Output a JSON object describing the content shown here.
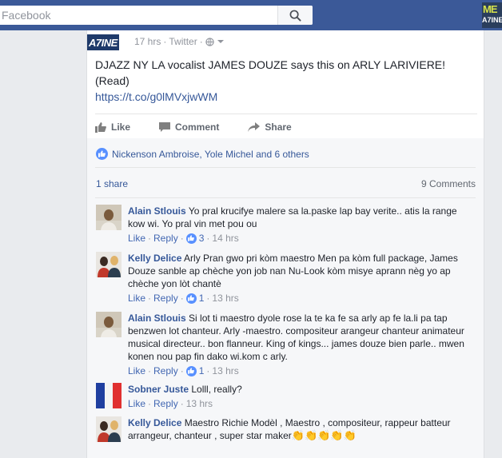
{
  "topbar": {
    "search_placeholder": "Facebook",
    "side_logo_top": "ME",
    "side_logo_bottom": "A7INE"
  },
  "post": {
    "avatar_text": "A7INE",
    "meta_time": "17 hrs",
    "meta_sep": "·",
    "meta_source": "Twitter",
    "meta_sep2": "·",
    "text": "DJAZZ NY LA vocalist JAMES DOUZE says this on ARLY LARIVIERE! (Read)",
    "link": "https://t.co/g0lMVxjwWM",
    "actions": {
      "like": "Like",
      "comment": "Comment",
      "share": "Share"
    },
    "likers": "Nickenson Ambroise, Yole Michel and 6 others",
    "shares": "1 share",
    "comments_count": "9 Comments"
  },
  "comments": [
    {
      "name": "Alain Stlouis",
      "text": "Yo pral krucifye malere sa la.paske lap bay verite.. atis la range kow wi. Yo pral vin met pou ou",
      "like": "Like",
      "reply": "Reply",
      "sep": "·",
      "likes": "3",
      "time": "14 hrs"
    },
    {
      "name": "Kelly Delice",
      "text": "Arly Pran gwo pri kòm maestro Men pa kòm full package, James Douze sanble ap chèche yon job nan Nu-Look kòm misye aprann nèg yo ap chèche yon lòt chantè",
      "like": "Like",
      "reply": "Reply",
      "sep": "·",
      "likes": "1",
      "time": "13 hrs"
    },
    {
      "name": "Alain Stlouis",
      "text": "Si lot ti maestro dyole rose la te ka fe sa arly ap fe la.li pa tap benzwen lot chanteur. Arly -maestro. compositeur arangeur chanteur animateur musical directeur.. bon flanneur. King of kings... james douze bien parle.. mwen konen nou pap fin dako wi.kom c arly.",
      "like": "Like",
      "reply": "Reply",
      "sep": "·",
      "likes": "1",
      "time": "13 hrs"
    },
    {
      "name": "Sobner Juste",
      "text": "Lolll, really?",
      "like": "Like",
      "reply": "Reply",
      "sep": "·",
      "time": "13 hrs"
    },
    {
      "name": "Kelly Delice",
      "text": "Maestro Richie Modèl , Maestro , compositeur, rappeur batteur arrangeur, chanteur , super star maker",
      "claps": "👏👏👏👏👏"
    }
  ],
  "colors": {
    "brand": "#3b5998",
    "link": "#365899",
    "like_blue": "#5890ff"
  }
}
